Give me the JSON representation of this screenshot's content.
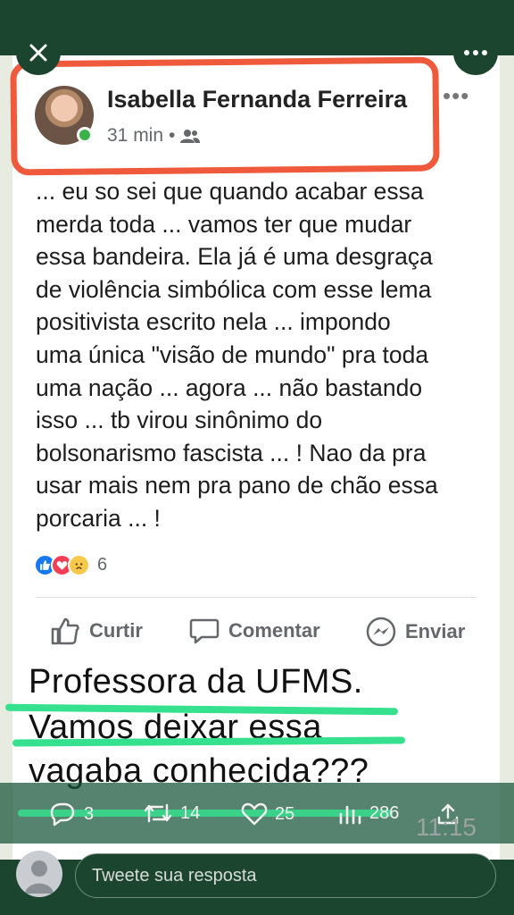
{
  "colors": {
    "background": "#1f4a34",
    "highlight_red": "#ef5a3c",
    "highlight_green": "#35e08e",
    "online": "#3bb34a"
  },
  "post": {
    "author": "Isabella Fernanda Ferreira",
    "time": "31 min",
    "audience_icon": "friends-icon",
    "options": "•••",
    "body_lines": [
      "... eu so sei que quando acabar essa",
      "merda toda ... vamos ter que mudar",
      "essa bandeira. Ela já é uma desgraça",
      "de violência simbólica com esse lema",
      "positivista escrito nela ... impondo",
      "uma única \"visão de mundo\" pra toda",
      "uma nação ... agora ... não bastando",
      "isso ... tb virou sinônimo do",
      "bolsonarismo fascista ... ! Nao da pra",
      "usar mais nem pra pano de chão essa",
      "porcaria ... !"
    ],
    "reaction_count": "6",
    "actions": {
      "like": "Curtir",
      "comment": "Comentar",
      "send": "Enviar"
    }
  },
  "caption": {
    "line1": "Professora da UFMS.",
    "line2": "Vamos deixar essa",
    "line3": "vagaba conhecida???"
  },
  "tweet_stats": {
    "replies": "3",
    "retweets": "14",
    "likes": "25",
    "views": "286"
  },
  "image_timestamp": "11:15",
  "reply": {
    "placeholder": "Tweete sua resposta"
  }
}
